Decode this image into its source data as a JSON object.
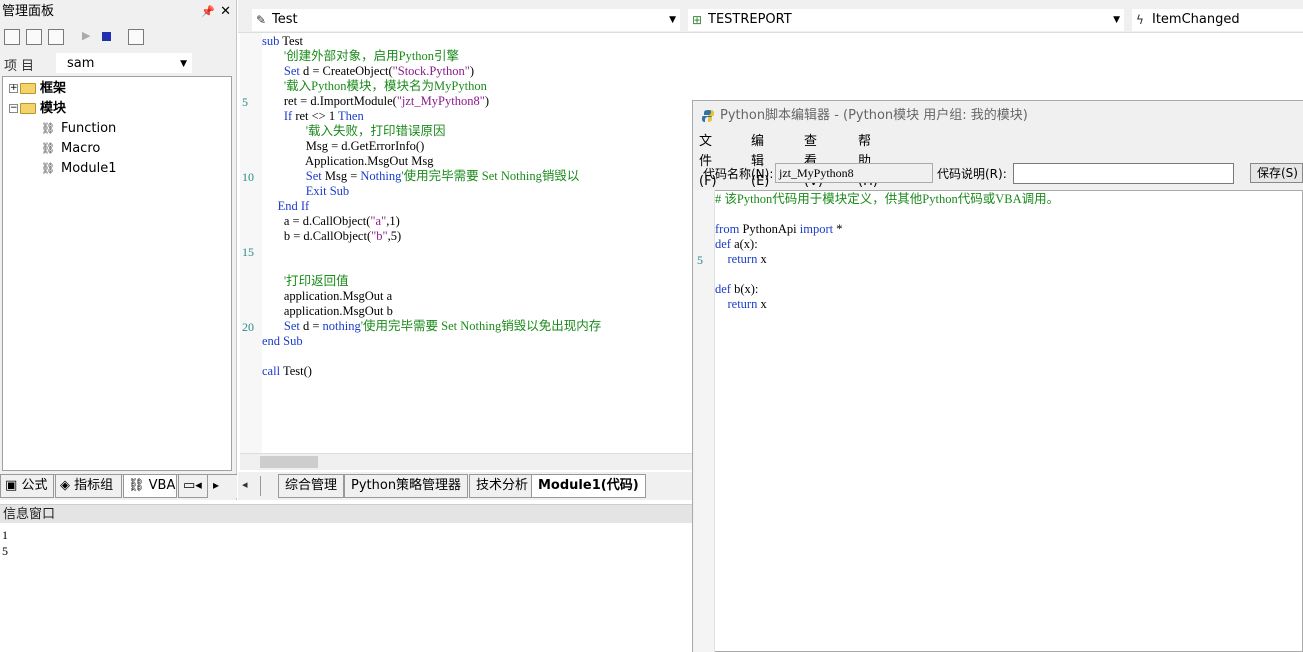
{
  "left_panel": {
    "title": "管理面板",
    "pin": "ᵖ",
    "close": "✕",
    "project_label": "项目",
    "project_value": "sam",
    "tree": [
      {
        "label": "框架",
        "type": "folder",
        "expanded": false
      },
      {
        "label": "模块",
        "type": "folder",
        "expanded": true
      },
      {
        "label": "Function",
        "type": "module"
      },
      {
        "label": "Macro",
        "type": "module"
      },
      {
        "label": "Module1",
        "type": "module"
      }
    ],
    "tabs": [
      "公式",
      "指标组",
      "VBA",
      ""
    ]
  },
  "editor_header": {
    "proc": "Test",
    "object": "TESTREPORT",
    "event": "ItemChanged"
  },
  "code_lines": [
    {
      "n": "",
      "parts": [
        {
          "c": "kw",
          "t": "sub"
        },
        {
          "c": "",
          "t": " Test"
        }
      ]
    },
    {
      "n": "",
      "parts": [
        {
          "c": "cm",
          "t": "       '创建外部对象，启用Python引擎"
        }
      ]
    },
    {
      "n": "",
      "parts": [
        {
          "c": "kw",
          "t": "       Set"
        },
        {
          "c": "",
          "t": " d = CreateObject("
        },
        {
          "c": "st",
          "t": "\"Stock.Python\""
        },
        {
          "c": "",
          "t": ")"
        }
      ]
    },
    {
      "n": "",
      "parts": [
        {
          "c": "cm",
          "t": "       '载入Python模块，模块名为MyPython"
        }
      ]
    },
    {
      "n": "5",
      "parts": [
        {
          "c": "",
          "t": "       ret = d.ImportModule("
        },
        {
          "c": "st",
          "t": "\"jzt_MyPython8\""
        },
        {
          "c": "",
          "t": ")"
        }
      ]
    },
    {
      "n": "",
      "parts": [
        {
          "c": "kw",
          "t": "       If"
        },
        {
          "c": "",
          "t": " ret <> 1 "
        },
        {
          "c": "kw",
          "t": "Then"
        }
      ]
    },
    {
      "n": "",
      "parts": [
        {
          "c": "cm",
          "t": "              '载入失败，打印错误原因"
        }
      ]
    },
    {
      "n": "",
      "parts": [
        {
          "c": "",
          "t": "              Msg = d.GetErrorInfo()"
        }
      ]
    },
    {
      "n": "",
      "parts": [
        {
          "c": "",
          "t": "              Application.MsgOut Msg"
        }
      ]
    },
    {
      "n": "10",
      "parts": [
        {
          "c": "kw",
          "t": "              Set"
        },
        {
          "c": "",
          "t": " Msg = "
        },
        {
          "c": "kw",
          "t": "Nothing"
        },
        {
          "c": "cm",
          "t": "'使用完毕需要 Set Nothing销毁以"
        }
      ]
    },
    {
      "n": "",
      "parts": [
        {
          "c": "kw",
          "t": "              Exit Sub"
        }
      ]
    },
    {
      "n": "",
      "parts": [
        {
          "c": "kw",
          "t": "     End If"
        }
      ]
    },
    {
      "n": "",
      "parts": [
        {
          "c": "",
          "t": "       a = d.CallObject("
        },
        {
          "c": "st",
          "t": "\"a\""
        },
        {
          "c": "",
          "t": ",1)"
        }
      ]
    },
    {
      "n": "",
      "parts": [
        {
          "c": "",
          "t": "       b = d.CallObject("
        },
        {
          "c": "st",
          "t": "\"b\""
        },
        {
          "c": "",
          "t": ",5)"
        }
      ]
    },
    {
      "n": "15",
      "parts": []
    },
    {
      "n": "",
      "parts": []
    },
    {
      "n": "",
      "parts": [
        {
          "c": "cm",
          "t": "       '打印返回值"
        }
      ]
    },
    {
      "n": "",
      "parts": [
        {
          "c": "",
          "t": "       application.MsgOut a"
        }
      ]
    },
    {
      "n": "",
      "parts": [
        {
          "c": "",
          "t": "       application.MsgOut b"
        }
      ]
    },
    {
      "n": "20",
      "parts": [
        {
          "c": "kw",
          "t": "       Set"
        },
        {
          "c": "",
          "t": " d = "
        },
        {
          "c": "kw",
          "t": "nothing"
        },
        {
          "c": "cm",
          "t": "'使用完毕需要 Set Nothing销毁以免出现内存"
        }
      ]
    },
    {
      "n": "",
      "parts": [
        {
          "c": "kw",
          "t": "end Sub"
        }
      ]
    },
    {
      "n": "",
      "parts": []
    },
    {
      "n": "",
      "parts": [
        {
          "c": "kw",
          "t": "call"
        },
        {
          "c": "",
          "t": " Test()"
        }
      ]
    }
  ],
  "doc_tabs": [
    "综合管理",
    "Python策略管理器",
    "技术分析",
    "Module1(代码)"
  ],
  "info": {
    "title": "信息窗口",
    "lines": [
      "1",
      "5"
    ]
  },
  "python_editor": {
    "title": "Python脚本编辑器 - (Python模块 用户组: 我的模块)",
    "menu": [
      "文件(F)",
      "编辑(E)",
      "查看(V)",
      "帮助(H)"
    ],
    "code_name_label": "代码名称(N):",
    "code_name_value": "jzt_MyPython8",
    "code_desc_label": "代码说明(R):",
    "save_label": "保存(S)",
    "code_lines": [
      {
        "n": "",
        "parts": [
          {
            "c": "cm",
            "t": "# 该Python代码用于模块定义，供其他Python代码或VBA调用。"
          }
        ]
      },
      {
        "n": "",
        "parts": []
      },
      {
        "n": "",
        "parts": [
          {
            "c": "kw",
            "t": "from"
          },
          {
            "c": "",
            "t": " PythonApi "
          },
          {
            "c": "kw",
            "t": "import"
          },
          {
            "c": "",
            "t": " *"
          }
        ]
      },
      {
        "n": "",
        "parts": [
          {
            "c": "kw",
            "t": "def"
          },
          {
            "c": "",
            "t": " a(x):"
          }
        ]
      },
      {
        "n": "5",
        "parts": [
          {
            "c": "kw",
            "t": "    return"
          },
          {
            "c": "",
            "t": " x"
          }
        ]
      },
      {
        "n": "",
        "parts": []
      },
      {
        "n": "",
        "parts": [
          {
            "c": "kw",
            "t": "def"
          },
          {
            "c": "",
            "t": " b(x):"
          }
        ]
      },
      {
        "n": "",
        "parts": [
          {
            "c": "kw",
            "t": "    return"
          },
          {
            "c": "",
            "t": " x"
          }
        ]
      }
    ]
  }
}
